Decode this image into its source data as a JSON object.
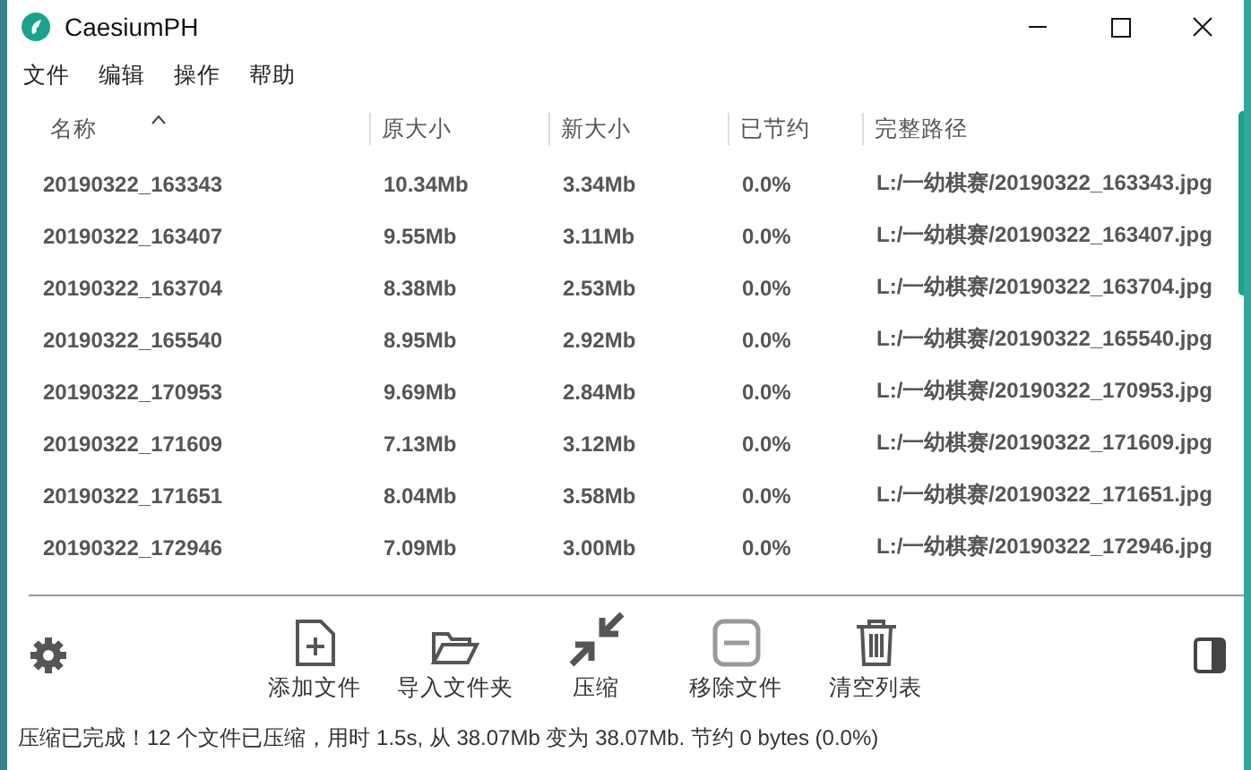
{
  "window": {
    "title": "CaesiumPH"
  },
  "menu": [
    "文件",
    "编辑",
    "操作",
    "帮助"
  ],
  "table": {
    "columns": [
      {
        "label": "名称",
        "sorted": true
      },
      {
        "label": "原大小",
        "sorted": false
      },
      {
        "label": "新大小",
        "sorted": false
      },
      {
        "label": "已节约",
        "sorted": false
      },
      {
        "label": "完整路径",
        "sorted": false
      }
    ],
    "rows": [
      [
        "20190322_163343",
        "10.34Mb",
        "3.34Mb",
        "0.0%",
        "L:/一幼棋赛/20190322_163343.jpg"
      ],
      [
        "20190322_163407",
        "9.55Mb",
        "3.11Mb",
        "0.0%",
        "L:/一幼棋赛/20190322_163407.jpg"
      ],
      [
        "20190322_163704",
        "8.38Mb",
        "2.53Mb",
        "0.0%",
        "L:/一幼棋赛/20190322_163704.jpg"
      ],
      [
        "20190322_165540",
        "8.95Mb",
        "2.92Mb",
        "0.0%",
        "L:/一幼棋赛/20190322_165540.jpg"
      ],
      [
        "20190322_170953",
        "9.69Mb",
        "2.84Mb",
        "0.0%",
        "L:/一幼棋赛/20190322_170953.jpg"
      ],
      [
        "20190322_171609",
        "7.13Mb",
        "3.12Mb",
        "0.0%",
        "L:/一幼棋赛/20190322_171609.jpg"
      ],
      [
        "20190322_171651",
        "8.04Mb",
        "3.58Mb",
        "0.0%",
        "L:/一幼棋赛/20190322_171651.jpg"
      ],
      [
        "20190322_172946",
        "7.09Mb",
        "3.00Mb",
        "0.0%",
        "L:/一幼棋赛/20190322_172946.jpg"
      ]
    ]
  },
  "toolbar": [
    {
      "kind": "add",
      "label": "添加文件",
      "disabled": false
    },
    {
      "kind": "import",
      "label": "导入文件夹",
      "disabled": false
    },
    {
      "kind": "compress",
      "label": "压缩",
      "disabled": false
    },
    {
      "kind": "remove",
      "label": "移除文件",
      "disabled": true
    },
    {
      "kind": "clear",
      "label": "清空列表",
      "disabled": false
    }
  ],
  "status_bar": "压缩已完成！12 个文件已压缩，用时 1.5s, 从 38.07Mb 变为 38.07Mb. 节约 0 bytes (0.0%)"
}
